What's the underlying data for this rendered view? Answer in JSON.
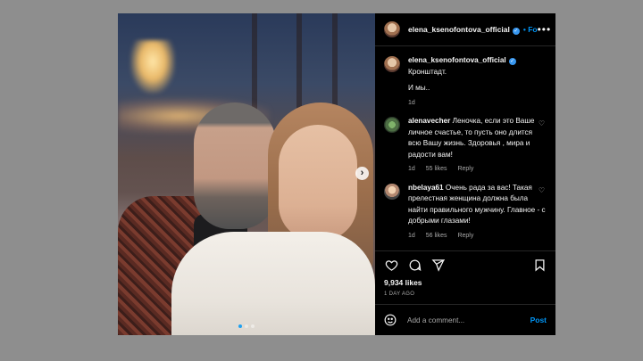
{
  "post": {
    "username": "elena_ksenofontova_official",
    "follow_label": "Fo",
    "caption_lines": [
      "Кронштадт.",
      "И мы.."
    ],
    "caption_time": "1d",
    "carousel_dots": 3,
    "active_dot": 0
  },
  "comments": [
    {
      "username": "alenavecher",
      "text": "Леночка, если это Ваше личное счастье, то пусть оно длится всю Вашу жизнь. Здоровья , мира и радости вам!",
      "time": "1d",
      "likes": "55 likes",
      "reply": "Reply"
    },
    {
      "username": "nbelaya61",
      "text": "Очень рада за вас! Такая прелестная женщина должна была найти правильного мужчину. Главное - с добрыми глазами!",
      "time": "1d",
      "likes": "56 likes",
      "reply": "Reply"
    }
  ],
  "stats": {
    "likes": "9,934 likes",
    "date": "1 DAY AGO"
  },
  "composer": {
    "placeholder": "Add a comment...",
    "post_label": "Post"
  },
  "colors": {
    "accent": "#0095f6",
    "background": "#000000",
    "outside": "#8e8e8e"
  }
}
